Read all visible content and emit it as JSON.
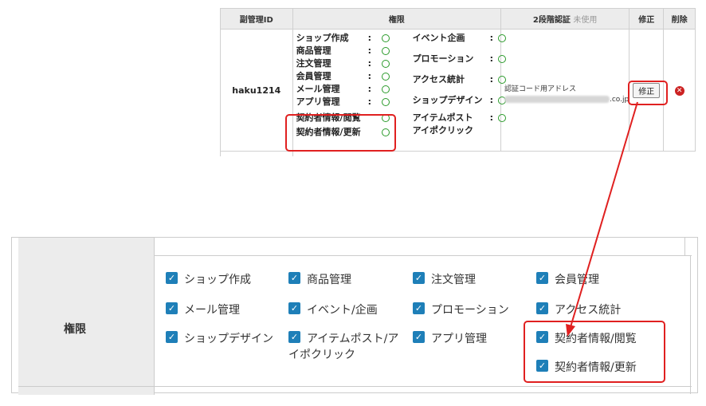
{
  "top": {
    "headers": {
      "sub_admin_id": "副管理ID",
      "permissions": "権限",
      "two_factor": "2段階認証",
      "two_factor_status": "未使用",
      "edit": "修正",
      "delete": "削除"
    },
    "row": {
      "id": "haku1214",
      "permissions_left": [
        {
          "label": "ショップ作成",
          "sep": ":"
        },
        {
          "label": "商品管理",
          "sep": ":"
        },
        {
          "label": "注文管理",
          "sep": ":"
        },
        {
          "label": "会員管理",
          "sep": ":"
        },
        {
          "label": "メール管理",
          "sep": ":"
        },
        {
          "label": "アプリ管理",
          "sep": ":"
        },
        {
          "label": "契約者情報/閲覧",
          "sep": ""
        },
        {
          "label": "契約者情報/更新",
          "sep": ""
        }
      ],
      "permissions_right": [
        {
          "label": "イベント企画",
          "sep": ":"
        },
        {
          "label": "プロモーション",
          "sep": ":"
        },
        {
          "label": "アクセス統計",
          "sep": ":"
        },
        {
          "label": "ショップデザイン",
          "sep": ":"
        },
        {
          "label": "アイテムポスト",
          "sep": ":"
        },
        {
          "label": "アイポクリック",
          "sep": ""
        }
      ],
      "auth_label": "認証コード用アドレス",
      "auth_domain": ".co.jp",
      "edit_button": "修正",
      "delete_icon": "close-icon"
    }
  },
  "bottom": {
    "section_label": "権限",
    "checkboxes": [
      {
        "label": "ショップ作成",
        "checked": true
      },
      {
        "label": "商品管理",
        "checked": true
      },
      {
        "label": "注文管理",
        "checked": true
      },
      {
        "label": "会員管理",
        "checked": true
      },
      {
        "label": "メール管理",
        "checked": true
      },
      {
        "label": "イベント/企画",
        "checked": true
      },
      {
        "label": "プロモーション",
        "checked": true
      },
      {
        "label": "アクセス統計",
        "checked": true
      },
      {
        "label": "ショップデザイン",
        "checked": true
      },
      {
        "label": "アイテムポスト/ア",
        "label2": "イポクリック",
        "checked": true
      },
      {
        "label": "アプリ管理",
        "checked": true
      },
      {
        "label": "契約者情報/閲覧",
        "checked": true
      },
      {
        "label": "契約者情報/更新",
        "checked": true
      }
    ]
  },
  "colors": {
    "highlight": "#e02020",
    "checkbox": "#1e7fb8",
    "ok_circle": "#2a9a2a",
    "header_bg": "#ececec"
  }
}
